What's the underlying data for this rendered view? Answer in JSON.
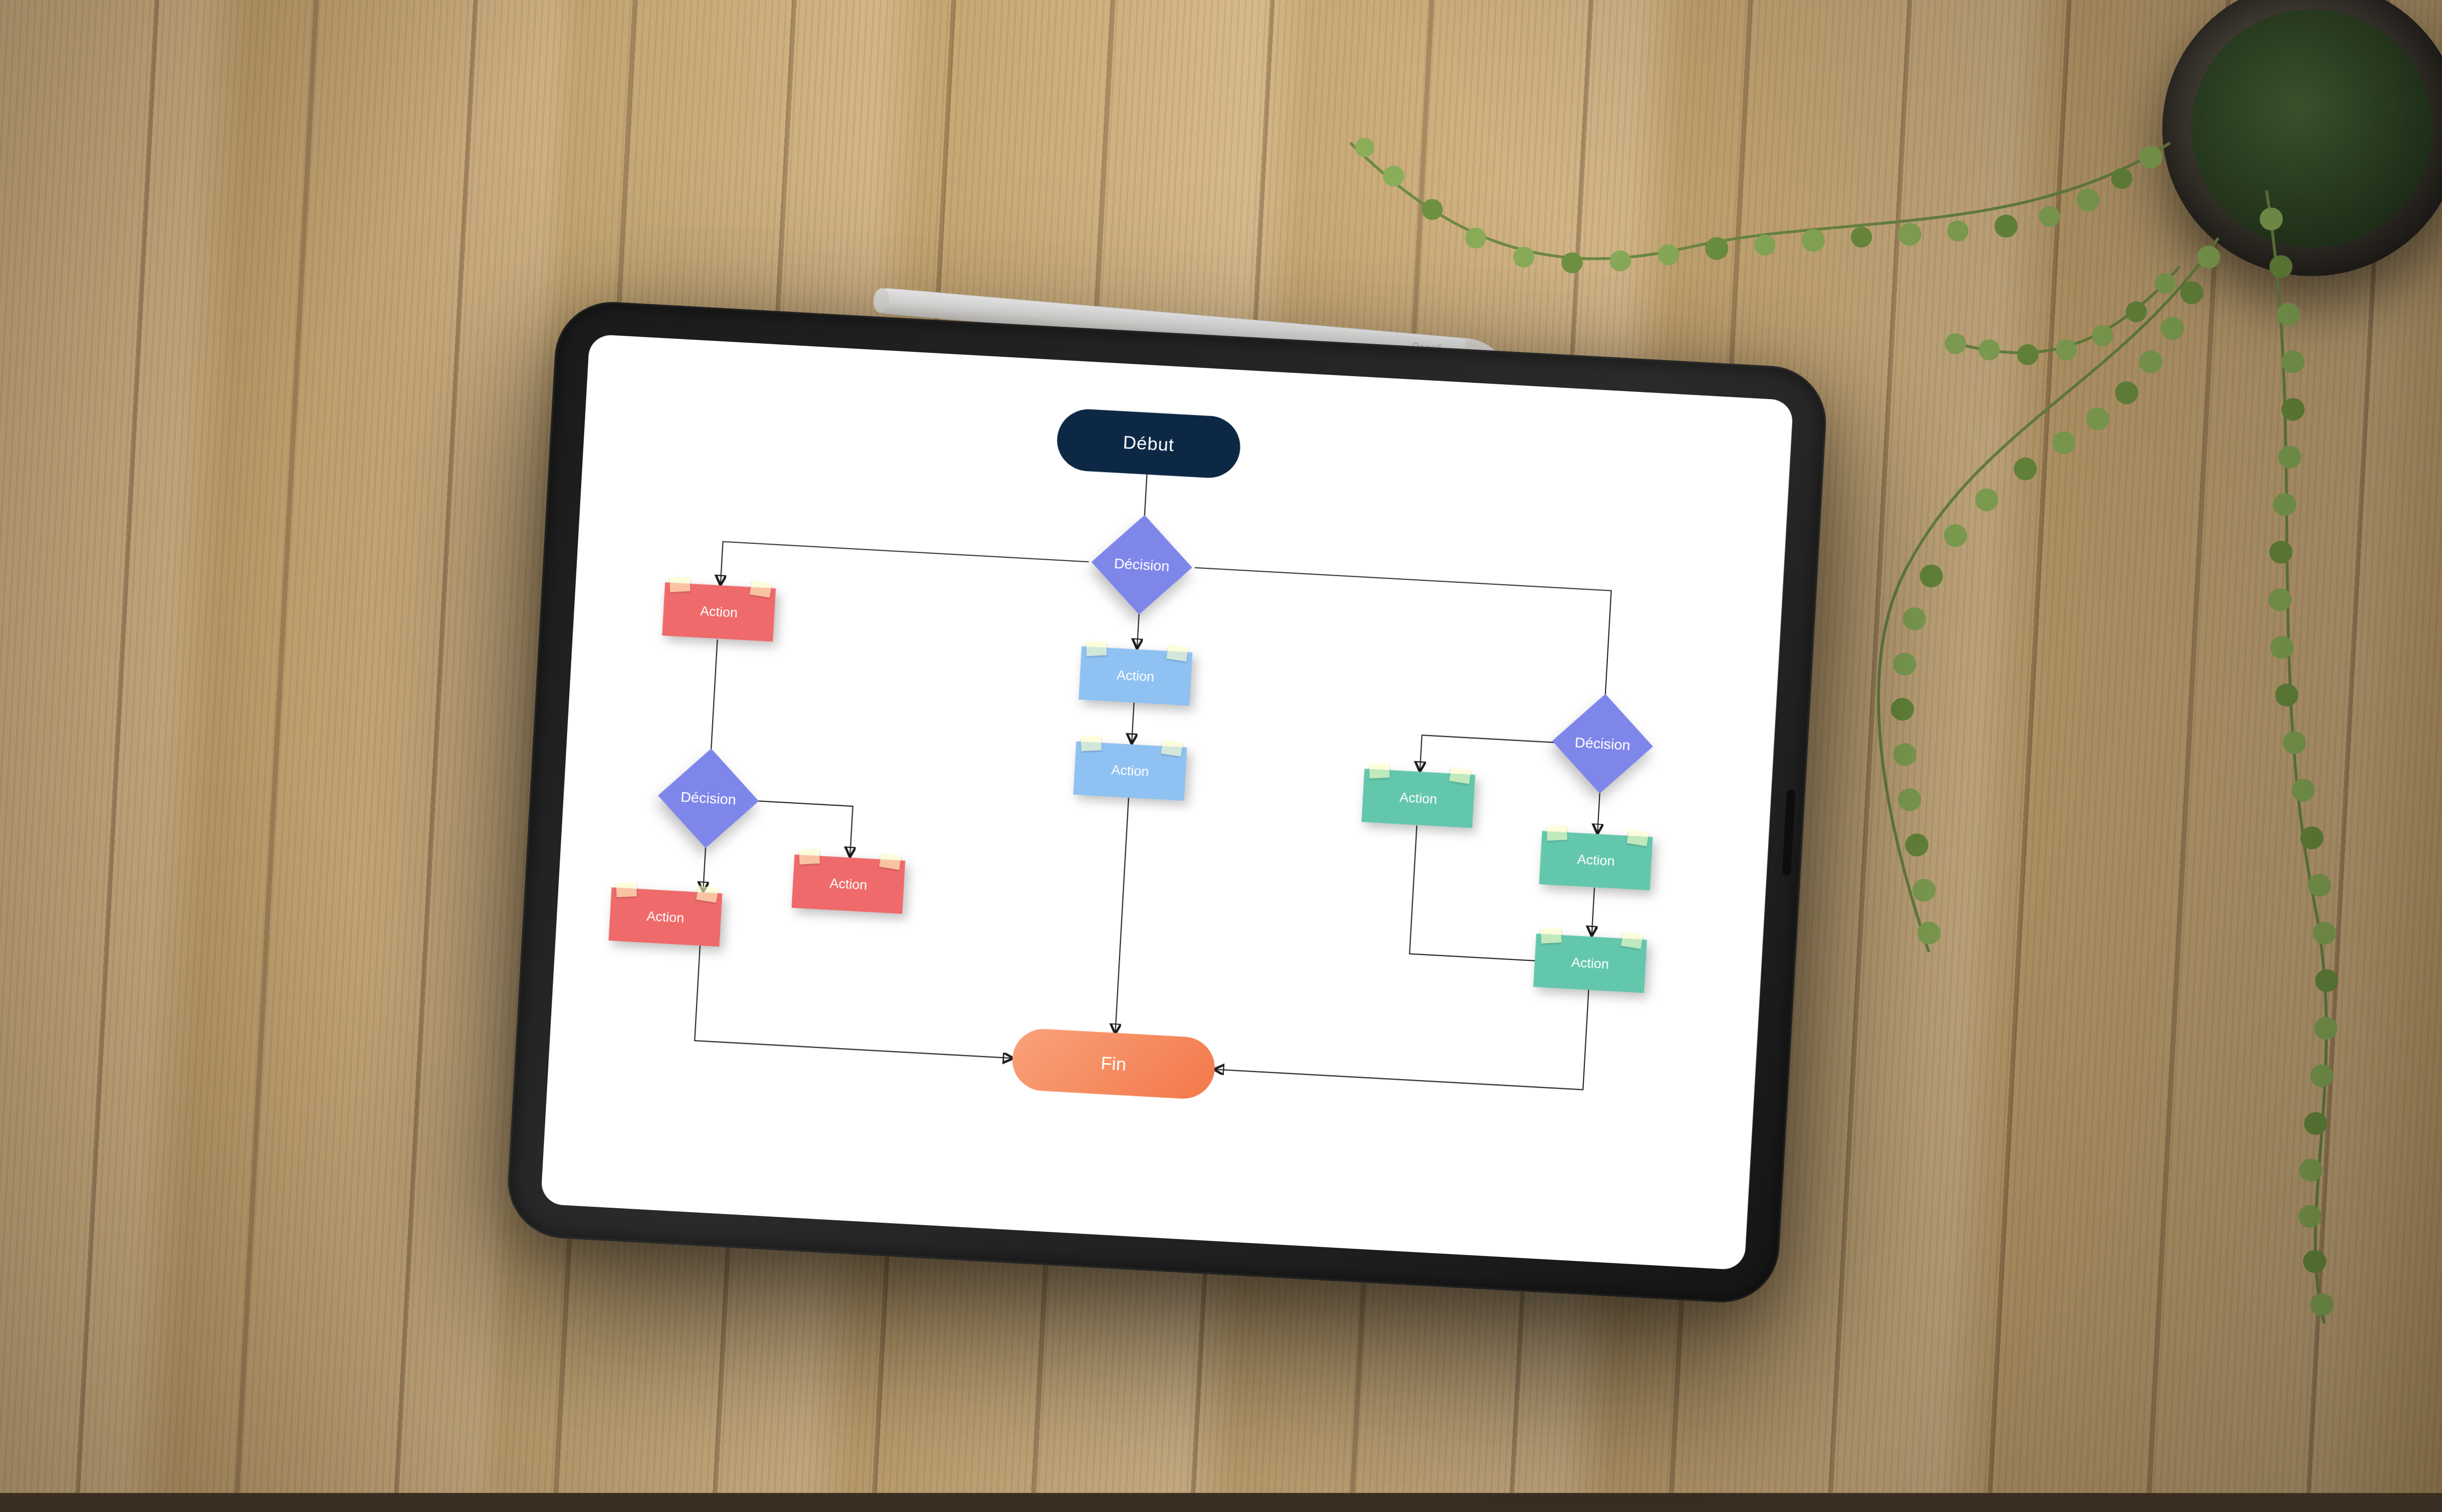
{
  "scene": {
    "device": "tablet",
    "stylus_label": "Pencil",
    "colors": {
      "start_node": "#0d2845",
      "decision_node": "#7e86ea",
      "action_red": "#ef6a6a",
      "action_blue": "#8fc1f3",
      "action_green": "#63c7ad",
      "end_node_gradient_from": "#f9a27a",
      "end_node_gradient_to": "#f3784a"
    }
  },
  "flowchart": {
    "start": "Début",
    "end": "Fin",
    "decision_top": "Décision",
    "decision_left": "Décision",
    "decision_right": "Décision",
    "left_branch": {
      "action1": "Action",
      "action2": "Action",
      "action3": "Action"
    },
    "center_branch": {
      "action1": "Action",
      "action2": "Action"
    },
    "right_branch": {
      "action_left": "Action",
      "action_r1": "Action",
      "action_r2": "Action"
    }
  }
}
